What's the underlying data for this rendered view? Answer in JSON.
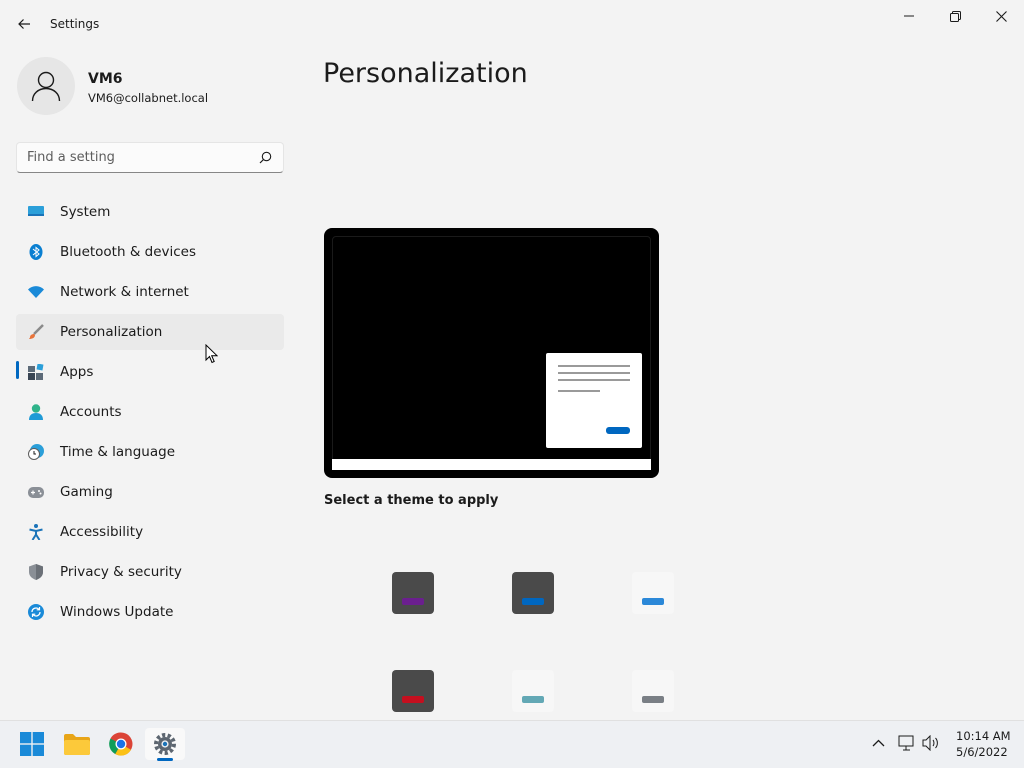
{
  "window": {
    "title": "Settings",
    "icons": {
      "back": "back-arrow-icon",
      "minimize": "minimize-icon",
      "maximize": "restore-icon",
      "close": "close-icon"
    }
  },
  "user": {
    "name": "VM6",
    "email": "VM6@collabnet.local"
  },
  "search": {
    "placeholder": "Find a setting",
    "value": ""
  },
  "nav": {
    "items": [
      {
        "label": "System",
        "icon": "system-icon"
      },
      {
        "label": "Bluetooth & devices",
        "icon": "bluetooth-icon"
      },
      {
        "label": "Network & internet",
        "icon": "wifi-icon"
      },
      {
        "label": "Personalization",
        "icon": "brush-icon"
      },
      {
        "label": "Apps",
        "icon": "apps-icon"
      },
      {
        "label": "Accounts",
        "icon": "accounts-icon"
      },
      {
        "label": "Time & language",
        "icon": "clock-globe-icon"
      },
      {
        "label": "Gaming",
        "icon": "gamepad-icon"
      },
      {
        "label": "Accessibility",
        "icon": "accessibility-icon"
      },
      {
        "label": "Privacy & security",
        "icon": "shield-icon"
      },
      {
        "label": "Windows Update",
        "icon": "update-icon"
      }
    ]
  },
  "main": {
    "title": "Personalization",
    "theme_section_label": "Select a theme to apply",
    "themes": [
      {
        "bg": "#4a4a4a",
        "accent": "#6b1f8f"
      },
      {
        "bg": "#4a4a4a",
        "accent": "#0067c0"
      },
      {
        "bg": "#f7f7f7",
        "accent": "#2b88d8"
      },
      {
        "bg": "#4a4a4a",
        "accent": "#c50f1f"
      },
      {
        "bg": "#f7f7f7",
        "accent": "#63a8b5"
      },
      {
        "bg": "#f7f7f7",
        "accent": "#7a7f85"
      }
    ]
  },
  "taskbar": {
    "apps": [
      "start-icon",
      "file-explorer-icon",
      "chrome-icon",
      "settings-icon"
    ],
    "time": "10:14 AM",
    "date": "5/6/2022"
  },
  "colors": {
    "accent": "#0067c0",
    "background": "#f3f3f3"
  }
}
